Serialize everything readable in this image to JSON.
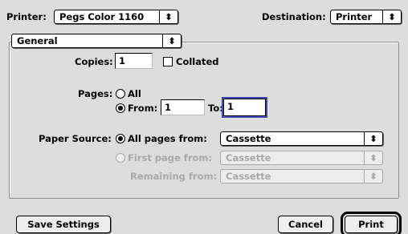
{
  "header": {
    "printer_label": "Printer:",
    "printer_value": "Pegs Color 1160",
    "destination_label": "Destination:",
    "destination_value": "Printer"
  },
  "section_popup": {
    "value": "General"
  },
  "copies": {
    "label": "Copies:",
    "value": "1",
    "collated_label": "Collated",
    "collated_checked": false
  },
  "pages": {
    "label": "Pages:",
    "all_label": "All",
    "from_label": "From:",
    "from_value": "1",
    "to_label": "To:",
    "to_value": "1",
    "selected": "from"
  },
  "paper_source": {
    "label": "Paper Source:",
    "all_pages_label": "All pages from:",
    "all_pages_value": "Cassette",
    "first_page_label": "First page from:",
    "first_page_value": "Cassette",
    "remaining_label": "Remaining from:",
    "remaining_value": "Cassette"
  },
  "buttons": {
    "save": "Save Settings",
    "cancel": "Cancel",
    "print": "Print"
  },
  "icons": {
    "popup_arrow": "⬍"
  }
}
